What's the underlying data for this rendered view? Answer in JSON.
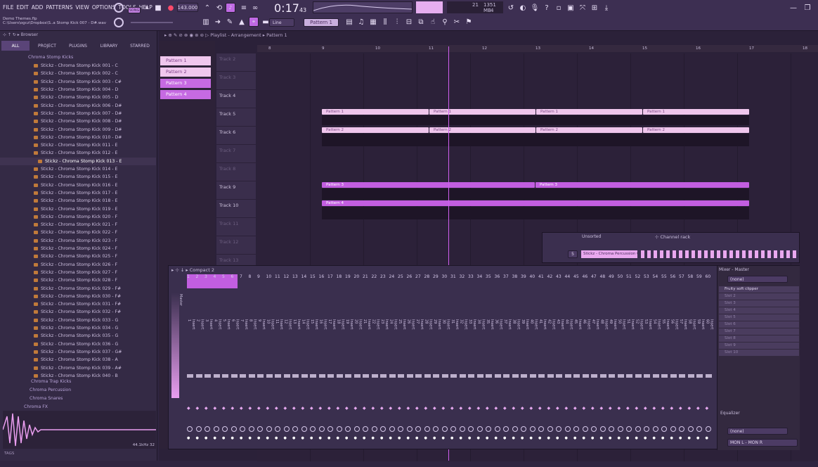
{
  "menu": [
    "FILE",
    "EDIT",
    "ADD",
    "PATTERNS",
    "VIEW",
    "OPTIONS",
    "TOOLS",
    "HELP"
  ],
  "transport": {
    "song_label": "SONG",
    "tempo": "143.000",
    "time": "0:17",
    "time_frac": "43",
    "mem": "1351 MB",
    "cpu": "21",
    "voices": "4"
  },
  "hint": {
    "title": "Demo Themes.flp",
    "path": "C:\\Users\\ogcz\\Dropbox\\S..a Stomp Kick 007 - D#.wav"
  },
  "toolbar2": {
    "snap": "Line",
    "pattern": "Pattern 1"
  },
  "browser": {
    "title": "Browser",
    "tabs": [
      "ALL",
      "PROJECT",
      "PLUGINS",
      "LIBRARY",
      "STARRED"
    ],
    "folder": "Chroma Stomp Kicks",
    "files": [
      "Stickz - Chroma Stomp Kick 001 - C",
      "Stickz - Chroma Stomp Kick 002 - C",
      "Stickz - Chroma Stomp Kick 003 - C#",
      "Stickz - Chroma Stomp Kick 004 - D",
      "Stickz - Chroma Stomp Kick 005 - D",
      "Stickz - Chroma Stomp Kick 006 - D#",
      "Stickz - Chroma Stomp Kick 007 - D#",
      "Stickz - Chroma Stomp Kick 008 - D#",
      "Stickz - Chroma Stomp Kick 009 - D#",
      "Stickz - Chroma Stomp Kick 010 - D#",
      "Stickz - Chroma Stomp Kick 011 - E",
      "Stickz - Chroma Stomp Kick 012 - E",
      "Stickz - Chroma Stomp Kick 013 - E",
      "Stickz - Chroma Stomp Kick 014 - E",
      "Stickz - Chroma Stomp Kick 015 - E",
      "Stickz - Chroma Stomp Kick 016 - E",
      "Stickz - Chroma Stomp Kick 017 - E",
      "Stickz - Chroma Stomp Kick 018 - E",
      "Stickz - Chroma Stomp Kick 019 - E",
      "Stickz - Chroma Stomp Kick 020 - F",
      "Stickz - Chroma Stomp Kick 021 - F",
      "Stickz - Chroma Stomp Kick 022 - F",
      "Stickz - Chroma Stomp Kick 023 - F",
      "Stickz - Chroma Stomp Kick 024 - F",
      "Stickz - Chroma Stomp Kick 025 - F",
      "Stickz - Chroma Stomp Kick 026 - F",
      "Stickz - Chroma Stomp Kick 027 - F",
      "Stickz - Chroma Stomp Kick 028 - F",
      "Stickz - Chroma Stomp Kick 029 - F#",
      "Stickz - Chroma Stomp Kick 030 - F#",
      "Stickz - Chroma Stomp Kick 031 - F#",
      "Stickz - Chroma Stomp Kick 032 - F#",
      "Stickz - Chroma Stomp Kick 033 - G",
      "Stickz - Chroma Stomp Kick 034 - G",
      "Stickz - Chroma Stomp Kick 035 - G",
      "Stickz - Chroma Stomp Kick 036 - G",
      "Stickz - Chroma Stomp Kick 037 - G#",
      "Stickz - Chroma Stomp Kick 038 - A",
      "Stickz - Chroma Stomp Kick 039 - A#",
      "Stickz - Chroma Stomp Kick 040 - B"
    ],
    "subfolders": [
      "Chroma Trap Kicks",
      "Chroma Percussion",
      "Chroma Snares",
      "Chroma FX"
    ],
    "sample_rate": "44.1",
    "bits": "32",
    "tags_label": "TAGS"
  },
  "playlist": {
    "title": "Playlist - Arrangement",
    "crumb": "Pattern 1",
    "patterns": [
      "Pattern 1",
      "Pattern 2",
      "Pattern 3",
      "Pattern 4"
    ],
    "bars": [
      "8",
      "9",
      "10",
      "11",
      "12",
      "13",
      "14",
      "15",
      "16",
      "17",
      "18"
    ],
    "tracks": [
      "Track 2",
      "Track 3",
      "Track 4",
      "Track 5",
      "Track 6",
      "Track 7",
      "Track 8",
      "Track 9",
      "Track 10",
      "Track 11",
      "Track 12",
      "Track 13"
    ],
    "clip_p1": "Pattern 1",
    "clip_p2": "Pattern 2",
    "clip_p3": "Pattern 3",
    "clip_p4": "Pattern 4"
  },
  "channel_rack": {
    "group": "Unsorted",
    "title": "Channel rack",
    "channel_num": "5",
    "channel_name": "Stickz - Chroma Percussion 002"
  },
  "mixer": {
    "title": "Compact 2",
    "master_label": "Master",
    "insert_prefix": "Insert",
    "master": {
      "title": "Mixer - Master",
      "input": "(none)",
      "plugin": "Fruity soft clipper",
      "slots": [
        "Slot 2",
        "Slot 3",
        "Slot 4",
        "Slot 5",
        "Slot 6",
        "Slot 7",
        "Slot 8",
        "Slot 9",
        "Slot 10"
      ],
      "eq": "Equalizer",
      "output_in": "(none)",
      "output": "MON L - MON R"
    }
  }
}
